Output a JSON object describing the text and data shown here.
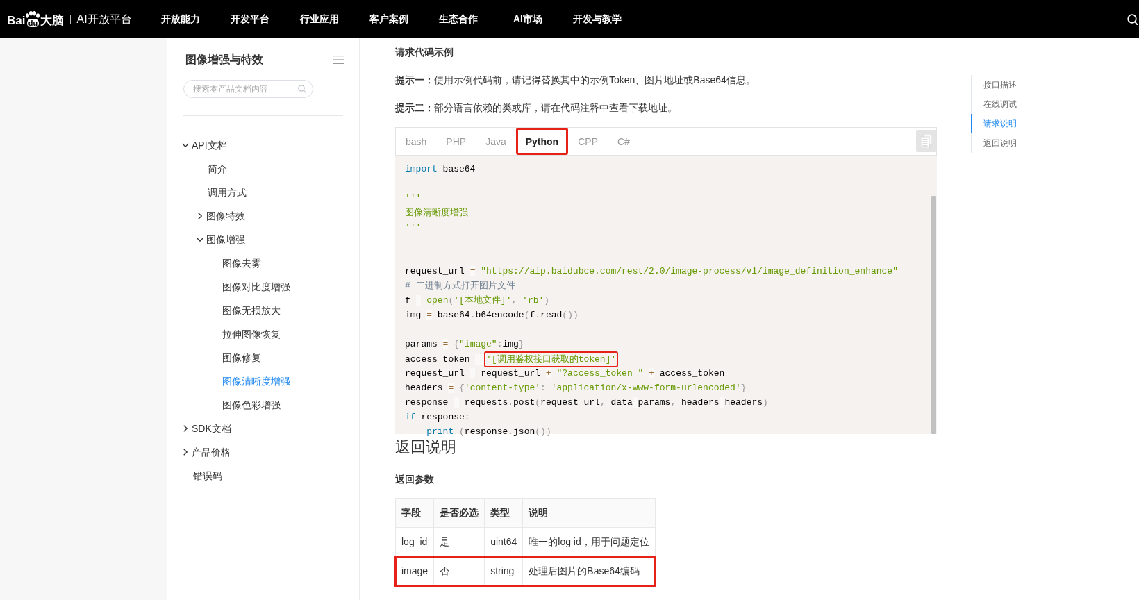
{
  "nav": {
    "logo": {
      "brand_start": "Bai",
      "brand_end": "du",
      "brand_suffix": "大脑"
    },
    "platform": "AI开放平台",
    "items": [
      "开放能力",
      "开发平台",
      "行业应用",
      "客户案例",
      "生态合作",
      "AI市场",
      "开发与教学"
    ]
  },
  "sidebar": {
    "title": "图像增强与特效",
    "search": {
      "placeholder": "搜索本产品文档内容"
    },
    "tree": [
      {
        "label": "API文档",
        "expanded": true,
        "selected": false,
        "children": [
          {
            "label": "简介",
            "selected": false
          },
          {
            "label": "调用方式",
            "selected": false
          },
          {
            "label": "图像特效",
            "expanded": false,
            "selected": false
          },
          {
            "label": "图像增强",
            "expanded": true,
            "selected": false,
            "children": [
              {
                "label": "图像去雾",
                "selected": false
              },
              {
                "label": "图像对比度增强",
                "selected": false
              },
              {
                "label": "图像无损放大",
                "selected": false
              },
              {
                "label": "拉伸图像恢复",
                "selected": false
              },
              {
                "label": "图像修复",
                "selected": false
              },
              {
                "label": "图像清晰度增强",
                "selected": true
              },
              {
                "label": "图像色彩增强",
                "selected": false
              }
            ]
          }
        ]
      },
      {
        "label": "SDK文档",
        "expanded": false,
        "selected": false
      },
      {
        "label": "产品价格",
        "expanded": false,
        "selected": false
      },
      {
        "label": "错误码",
        "selected": false
      }
    ]
  },
  "content": {
    "section_title": "请求代码示例",
    "tips": [
      "**提示一：**使用示例代码前，请记得替换其中的示例Token、图片地址或Base64信息。",
      "**提示二：**部分语言依赖的类或库，请在代码注释中查看下载地址。"
    ],
    "code_tabs": [
      {
        "label": "bash",
        "selected": false,
        "highlighted": false
      },
      {
        "label": "PHP",
        "selected": false,
        "highlighted": false
      },
      {
        "label": "Java",
        "selected": false,
        "highlighted": false
      },
      {
        "label": "Python",
        "selected": true,
        "highlighted": true
      },
      {
        "label": "CPP",
        "selected": false,
        "highlighted": false
      },
      {
        "label": "C#",
        "selected": false,
        "highlighted": false
      }
    ],
    "code_lines": [
      {
        "kind": "code",
        "tokens": [
          {
            "kind": "keyword",
            "text": "import"
          },
          {
            "kind": "plain",
            "text": " base64"
          }
        ]
      },
      {
        "kind": "blank"
      },
      {
        "kind": "code",
        "tokens": [
          {
            "kind": "string",
            "text": "'''"
          }
        ]
      },
      {
        "kind": "code",
        "tokens": [
          {
            "kind": "string",
            "text": "图像清晰度增强"
          }
        ]
      },
      {
        "kind": "code",
        "tokens": [
          {
            "kind": "string",
            "text": "'''"
          }
        ]
      },
      {
        "kind": "blank"
      },
      {
        "kind": "blank"
      },
      {
        "kind": "code",
        "tokens": [
          {
            "kind": "plain",
            "text": "request_url "
          },
          {
            "kind": "operator",
            "text": "="
          },
          {
            "kind": "string",
            "text": " \"https://aip.baidubce.com/rest/2.0/image-process/v1/image_definition_enhance\""
          }
        ]
      },
      {
        "kind": "code",
        "tokens": [
          {
            "kind": "comment",
            "text": "# 二进制方式打开图片文件"
          }
        ]
      },
      {
        "kind": "code",
        "tokens": [
          {
            "kind": "plain",
            "text": "f "
          },
          {
            "kind": "operator",
            "text": "="
          },
          {
            "kind": "builtin",
            "text": " open"
          },
          {
            "kind": "punctuation",
            "text": "("
          },
          {
            "kind": "string",
            "text": "'[本地文件]'"
          },
          {
            "kind": "punctuation",
            "text": ","
          },
          {
            "kind": "string",
            "text": " 'rb'"
          },
          {
            "kind": "punctuation",
            "text": ")"
          }
        ]
      },
      {
        "kind": "code",
        "tokens": [
          {
            "kind": "plain",
            "text": "img "
          },
          {
            "kind": "operator",
            "text": "="
          },
          {
            "kind": "plain",
            "text": " base64"
          },
          {
            "kind": "punctuation",
            "text": "."
          },
          {
            "kind": "plain",
            "text": "b64encode"
          },
          {
            "kind": "punctuation",
            "text": "("
          },
          {
            "kind": "plain",
            "text": "f"
          },
          {
            "kind": "punctuation",
            "text": "."
          },
          {
            "kind": "plain",
            "text": "read"
          },
          {
            "kind": "punctuation",
            "text": "())"
          }
        ]
      },
      {
        "kind": "blank"
      },
      {
        "kind": "code",
        "tokens": [
          {
            "kind": "plain",
            "text": "params "
          },
          {
            "kind": "operator",
            "text": "="
          },
          {
            "kind": "punctuation",
            "text": " {"
          },
          {
            "kind": "string",
            "text": "\"image\""
          },
          {
            "kind": "punctuation",
            "text": ":"
          },
          {
            "kind": "plain",
            "text": "img"
          },
          {
            "kind": "punctuation",
            "text": "}"
          }
        ]
      },
      {
        "kind": "code",
        "tokens": [
          {
            "kind": "plain",
            "text": "access_token "
          },
          {
            "kind": "operator",
            "text": "= "
          },
          {
            "kind": "string",
            "text": "'[调用鉴权接口获取的token]'",
            "highlighted": true
          }
        ]
      },
      {
        "kind": "code",
        "tokens": [
          {
            "kind": "plain",
            "text": "request_url "
          },
          {
            "kind": "operator",
            "text": "="
          },
          {
            "kind": "plain",
            "text": " request_url "
          },
          {
            "kind": "operator",
            "text": "+"
          },
          {
            "kind": "string",
            "text": " \"?access_token=\" "
          },
          {
            "kind": "operator",
            "text": "+"
          },
          {
            "kind": "plain",
            "text": " access_token"
          }
        ]
      },
      {
        "kind": "code",
        "tokens": [
          {
            "kind": "plain",
            "text": "headers "
          },
          {
            "kind": "operator",
            "text": "="
          },
          {
            "kind": "punctuation",
            "text": " {"
          },
          {
            "kind": "string",
            "text": "'content-type'"
          },
          {
            "kind": "punctuation",
            "text": ":"
          },
          {
            "kind": "string",
            "text": " 'application/x-www-form-urlencoded'"
          },
          {
            "kind": "punctuation",
            "text": "}"
          }
        ]
      },
      {
        "kind": "code",
        "tokens": [
          {
            "kind": "plain",
            "text": "response "
          },
          {
            "kind": "operator",
            "text": "="
          },
          {
            "kind": "plain",
            "text": " requests"
          },
          {
            "kind": "punctuation",
            "text": "."
          },
          {
            "kind": "plain",
            "text": "post"
          },
          {
            "kind": "punctuation",
            "text": "("
          },
          {
            "kind": "plain",
            "text": "request_url"
          },
          {
            "kind": "punctuation",
            "text": ","
          },
          {
            "kind": "plain",
            "text": " data"
          },
          {
            "kind": "operator",
            "text": "="
          },
          {
            "kind": "plain",
            "text": "params"
          },
          {
            "kind": "punctuation",
            "text": ","
          },
          {
            "kind": "plain",
            "text": " headers"
          },
          {
            "kind": "operator",
            "text": "="
          },
          {
            "kind": "plain",
            "text": "headers"
          },
          {
            "kind": "punctuation",
            "text": ")"
          }
        ]
      },
      {
        "kind": "code",
        "tokens": [
          {
            "kind": "keyword",
            "text": "if"
          },
          {
            "kind": "plain",
            "text": " response"
          },
          {
            "kind": "punctuation",
            "text": ":"
          }
        ]
      },
      {
        "kind": "code",
        "tokens": [
          {
            "kind": "keyword",
            "text": "    print"
          },
          {
            "kind": "punctuation",
            "text": " ("
          },
          {
            "kind": "plain",
            "text": "response"
          },
          {
            "kind": "punctuation",
            "text": "."
          },
          {
            "kind": "plain",
            "text": "json"
          },
          {
            "kind": "punctuation",
            "text": "())"
          }
        ]
      }
    ],
    "return_heading": "返回说明",
    "return_subheading": "返回参数",
    "return_table": {
      "columns": [
        "字段",
        "是否必选",
        "类型",
        "说明"
      ],
      "rows": [
        {
          "cells": [
            "log_id",
            "是",
            "uint64",
            "唯一的log id，用于问题定位"
          ],
          "highlighted": false
        },
        {
          "cells": [
            "image",
            "否",
            "string",
            "处理后图片的Base64编码"
          ],
          "highlighted": true
        }
      ]
    }
  },
  "toc": [
    {
      "label": "接口描述",
      "selected": false
    },
    {
      "label": "在线调试",
      "selected": false
    },
    {
      "label": "请求说明",
      "selected": true
    },
    {
      "label": "返回说明",
      "selected": false
    }
  ]
}
